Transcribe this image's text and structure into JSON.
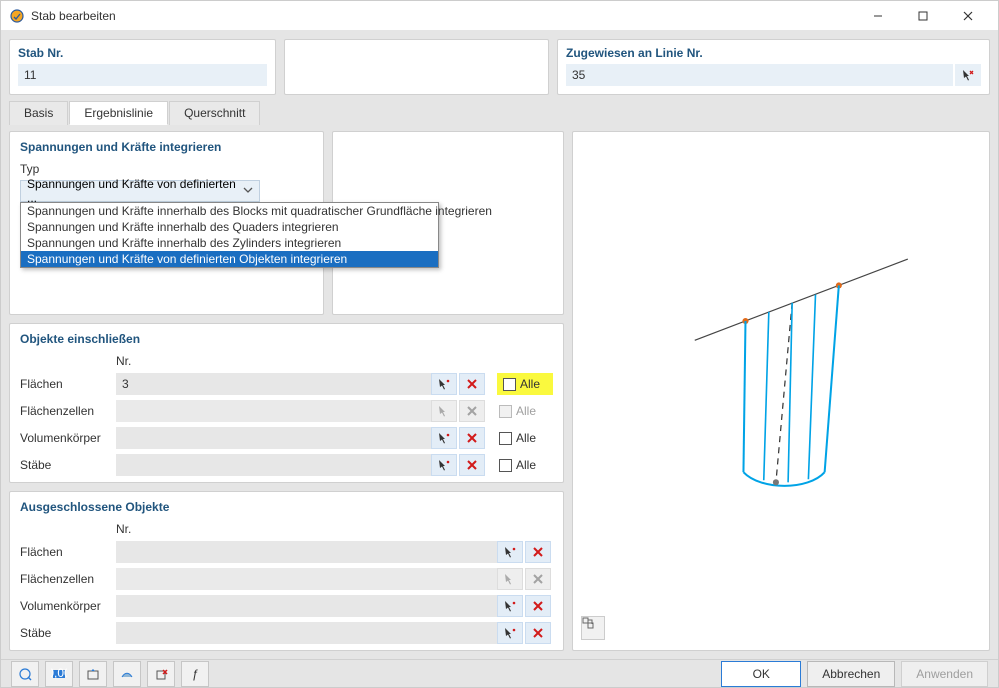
{
  "window": {
    "title": "Stab bearbeiten",
    "min": "—",
    "max": "☐",
    "close": "✕"
  },
  "top": {
    "stab_label": "Stab Nr.",
    "stab_value": "11",
    "line_label": "Zugewiesen an Linie Nr.",
    "line_value": "35"
  },
  "tabs": {
    "items": [
      "Basis",
      "Ergebnislinie",
      "Querschnitt"
    ],
    "active": 1
  },
  "integrate": {
    "group_title": "Spannungen und Kräfte integrieren",
    "typ_label": "Typ",
    "selected_display": "Spannungen und Kräfte von definierten ...",
    "options": [
      "Spannungen und Kräfte innerhalb des Blocks mit quadratischer Grundfläche integrieren",
      "Spannungen und Kräfte innerhalb des Quaders integrieren",
      "Spannungen und Kräfte innerhalb des Zylinders integrieren",
      "Spannungen und Kräfte von definierten Objekten integrieren"
    ],
    "selected_index": 3
  },
  "include": {
    "group_title": "Objekte einschließen",
    "nr_header": "Nr.",
    "rows": [
      {
        "label": "Flächen",
        "value": "3",
        "enabled": true,
        "all_checked": false,
        "all_label": "Alle",
        "highlight": true
      },
      {
        "label": "Flächenzellen",
        "value": "",
        "enabled": false,
        "all_checked": false,
        "all_label": "Alle",
        "highlight": false
      },
      {
        "label": "Volumenkörper",
        "value": "",
        "enabled": true,
        "all_checked": false,
        "all_label": "Alle",
        "highlight": false
      },
      {
        "label": "Stäbe",
        "value": "",
        "enabled": true,
        "all_checked": false,
        "all_label": "Alle",
        "highlight": false
      }
    ]
  },
  "exclude": {
    "group_title": "Ausgeschlossene Objekte",
    "nr_header": "Nr.",
    "rows": [
      {
        "label": "Flächen",
        "value": "",
        "enabled": true
      },
      {
        "label": "Flächenzellen",
        "value": "",
        "enabled": false
      },
      {
        "label": "Volumenkörper",
        "value": "",
        "enabled": true
      },
      {
        "label": "Stäbe",
        "value": "",
        "enabled": true
      }
    ]
  },
  "footer": {
    "ok": "OK",
    "cancel": "Abbrechen",
    "apply": "Anwenden"
  }
}
